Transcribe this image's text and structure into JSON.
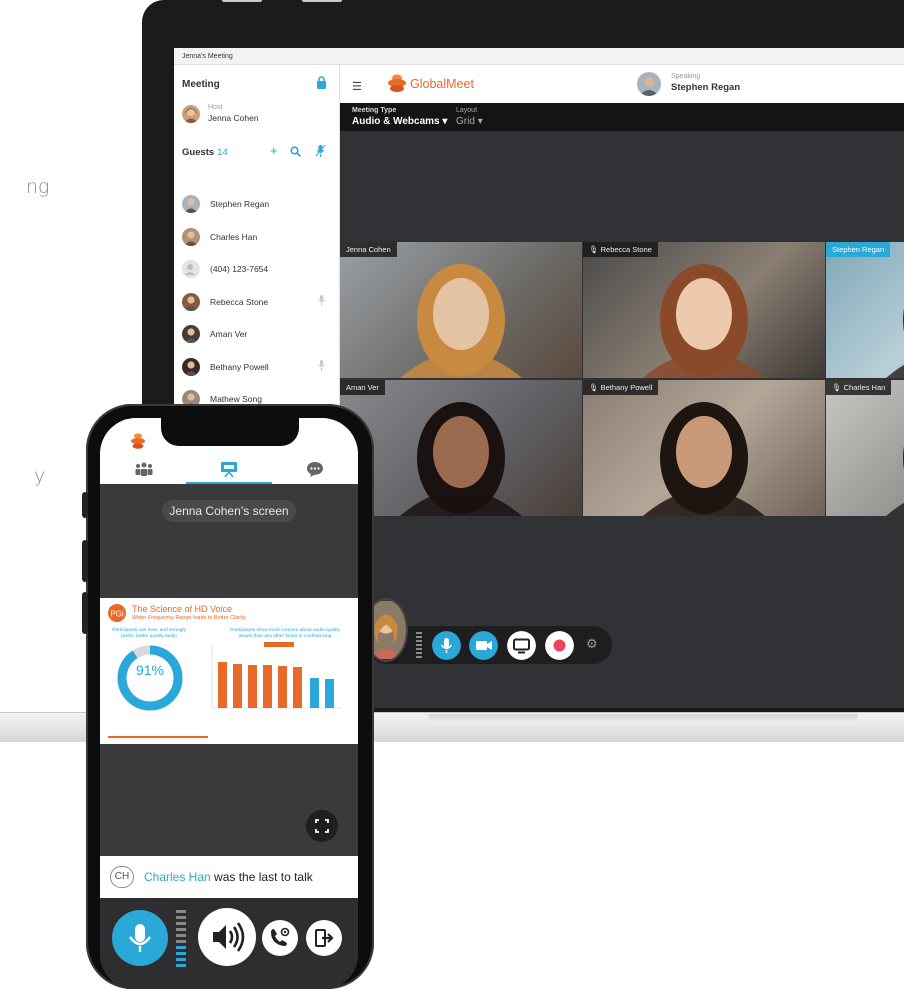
{
  "page_fragments": {
    "left_top": "ng",
    "left_mid": "y"
  },
  "window": {
    "title": "Jenna's Meeting"
  },
  "sidebar": {
    "heading": "Meeting",
    "host": {
      "role": "Host",
      "name": "Jenna Cohen"
    },
    "guests_label": "Guests",
    "guests_count": "14",
    "guests": [
      {
        "name": "Stephen Regan",
        "muted": false
      },
      {
        "name": "Charles Han",
        "muted": false
      },
      {
        "name": "(404) 123-7654",
        "muted": false
      },
      {
        "name": "Rebecca Stone",
        "muted": true
      },
      {
        "name": "Aman Ver",
        "muted": false
      },
      {
        "name": "Bethany Powell",
        "muted": true
      },
      {
        "name": "Mathew Song",
        "muted": false
      }
    ]
  },
  "header": {
    "brand_a": "Global",
    "brand_b": "Meet",
    "speaking_label": "Speaking",
    "speaking_name": "Stephen Regan"
  },
  "meeting_meta": {
    "type_label": "Meeting Type",
    "type_value": "Audio & Webcams",
    "layout_label": "Layout",
    "layout_value": "Grid"
  },
  "video_grid": [
    {
      "name": "Jenna Cohen",
      "active": false,
      "muted": false
    },
    {
      "name": "Rebecca Stone",
      "active": false,
      "muted": true
    },
    {
      "name": "Stephen Regan",
      "active": true,
      "muted": false
    },
    {
      "name": "Aman Ver",
      "active": false,
      "muted": false
    },
    {
      "name": "Bethany Powell",
      "active": false,
      "muted": true
    },
    {
      "name": "Charles Han",
      "active": false,
      "muted": true
    }
  ],
  "controls": [
    "mic",
    "camera",
    "screen-share",
    "record",
    "settings"
  ],
  "phone": {
    "screen_label": "Jenna Cohen’s screen",
    "slide_title": "The Science of HD Voice",
    "slide_subtitle": "Wider Frequency Range leads to Better Clarity",
    "slide_left_text": "Participants can hear, and strongly prefer, better quality audio",
    "slide_right_text": "Participants show more concern about audio quality issues than any other factor in conferencing",
    "slide_stat": "91%",
    "last_talk_initials": "CH",
    "last_talk_name": "Charles Han",
    "last_talk_suffix": "was the last to talk"
  },
  "colors": {
    "accent": "#2aa8d8",
    "brand_orange": "#e86a2a",
    "record": "#e8465b"
  }
}
